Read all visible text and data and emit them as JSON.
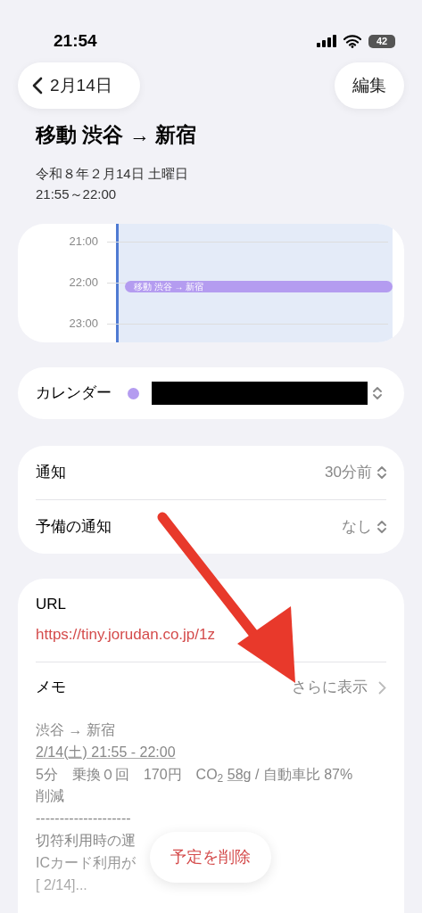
{
  "status_bar": {
    "time": "21:54",
    "battery": "42"
  },
  "nav": {
    "back": "2月14日",
    "edit": "編集"
  },
  "event": {
    "title": "移動 渋谷 → 新宿",
    "date": "令和８年２月14日 土曜日",
    "time": "21:55～22:00"
  },
  "timeline": {
    "hours": [
      "21:00",
      "22:00",
      "23:00"
    ],
    "event": {
      "label": "移動 渋谷 → 新宿",
      "color": "#b49cf0"
    }
  },
  "calendar": {
    "label": "カレンダー",
    "color": "#b49cf0",
    "redacted": true
  },
  "alerts": [
    {
      "label": "通知",
      "value": "30分前"
    },
    {
      "label": "予備の通知",
      "value": "なし"
    }
  ],
  "url": {
    "label": "URL",
    "value": "https://tiny.jorudan.co.jp/1z"
  },
  "memo": {
    "label": "メモ",
    "more": "さらに表示",
    "lines": [
      {
        "parts": [
          {
            "text": "渋谷 → 新宿",
            "underlined": false
          }
        ]
      },
      {
        "parts": [
          {
            "text": " 2/14(土) 21:55 - 22:00",
            "underlined": true
          }
        ]
      },
      {
        "parts": [
          {
            "text": "5分　乗換０回　170円　CO$_{2}$ ",
            "underlined": false
          },
          {
            "text": "58g",
            "underlined": true
          },
          {
            "text": " / 自動車比 87% 削減",
            "underlined": false
          }
        ]
      },
      {
        "parts": [
          {
            "text": "--------------------",
            "underlined": false
          }
        ]
      },
      {
        "parts": [
          {
            "text": "切符利用時の運",
            "underlined": false
          }
        ]
      },
      {
        "parts": [
          {
            "text": "ICカード利用が",
            "underlined": false
          }
        ]
      },
      {
        "parts": [
          {
            "text": "[ 2/14]...",
            "underlined": false
          }
        ]
      }
    ]
  },
  "delete_button": "予定を削除"
}
